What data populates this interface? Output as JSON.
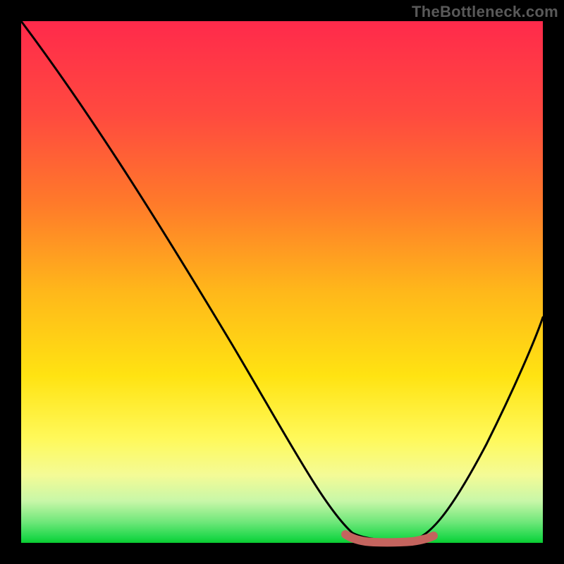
{
  "watermark": "TheBottleneck.com",
  "chart_data": {
    "type": "line",
    "title": "",
    "xlabel": "",
    "ylabel": "",
    "xlim": [
      0,
      100
    ],
    "ylim": [
      0,
      100
    ],
    "series": [
      {
        "name": "bottleneck-curve",
        "x": [
          0,
          8,
          16,
          24,
          32,
          40,
          48,
          56,
          60,
          64,
          68,
          72,
          76,
          80,
          84,
          90,
          95,
          100
        ],
        "values": [
          100,
          88,
          76,
          64,
          52,
          40,
          28,
          14,
          7,
          2,
          1,
          1,
          1,
          2,
          6,
          18,
          30,
          43
        ]
      },
      {
        "name": "optimal-range",
        "x": [
          62,
          66,
          70,
          74,
          78
        ],
        "values": [
          1.5,
          0.8,
          0.6,
          0.8,
          1.5
        ]
      }
    ],
    "colors": {
      "curve": "#000000",
      "optimal": "#c4645e"
    }
  }
}
